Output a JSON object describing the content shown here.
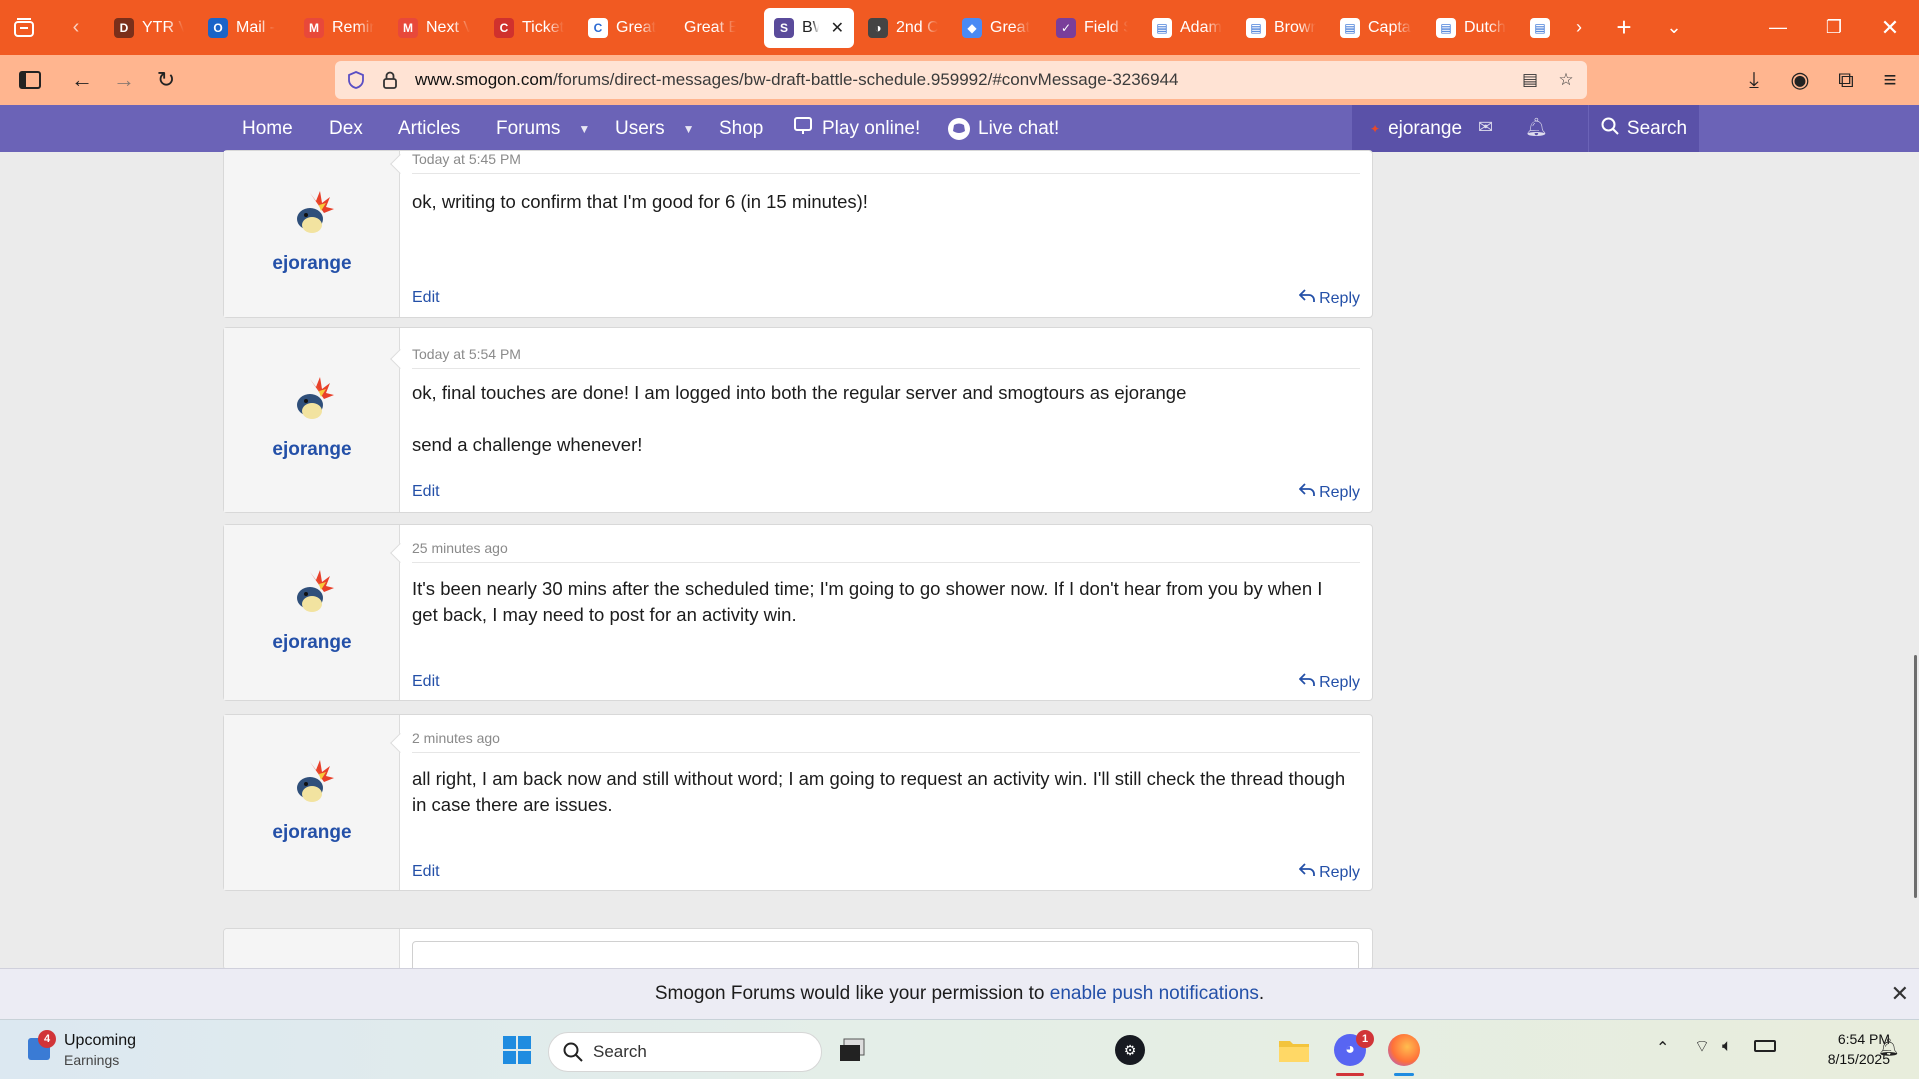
{
  "browser": {
    "tabs": [
      {
        "label": "YTR V",
        "icon": "D",
        "color": "#7a2f1a"
      },
      {
        "label": "Mail -",
        "icon": "O",
        "color": "#1a64c8"
      },
      {
        "label": "Remin",
        "icon": "M",
        "color": "#e8483a"
      },
      {
        "label": "Next V",
        "icon": "M",
        "color": "#e8483a"
      },
      {
        "label": "Ticket",
        "icon": "C",
        "color": "#d0312d"
      },
      {
        "label": "Great",
        "icon": "C",
        "color": "#ffffff"
      },
      {
        "label": "Great Brid",
        "icon": "",
        "color": "transparent"
      },
      {
        "label": "BW",
        "icon": "S",
        "color": "#5a4b9b"
      },
      {
        "label": "2nd C",
        "icon": "◑",
        "color": "#444444"
      },
      {
        "label": "Great",
        "icon": "◆",
        "color": "#4a8af4"
      },
      {
        "label": "Field S",
        "icon": "✓",
        "color": "#7a3e9a"
      },
      {
        "label": "Adam",
        "icon": "▤",
        "color": "#ffffff"
      },
      {
        "label": "Brown",
        "icon": "▤",
        "color": "#ffffff"
      },
      {
        "label": "Captai",
        "icon": "▤",
        "color": "#ffffff"
      },
      {
        "label": "Dutch",
        "icon": "▤",
        "color": "#ffffff"
      },
      {
        "label": "",
        "icon": "▤",
        "color": "#ffffff"
      }
    ],
    "active_tab_index": 7,
    "url_host": "www.smogon.com",
    "url_path": "/forums/direct-messages/bw-draft-battle-schedule.959992/#convMessage-3236944"
  },
  "site_nav": {
    "home": "Home",
    "dex": "Dex",
    "articles": "Articles",
    "forums": "Forums",
    "users": "Users",
    "shop": "Shop",
    "play": "Play online!",
    "chat": "Live chat!",
    "account": "ejorange",
    "search": "Search"
  },
  "messages": [
    {
      "user": "ejorange",
      "time": "Today at 5:45 PM",
      "paragraphs": [
        "ok, writing to confirm that I'm good for 6 (in 15 minutes)!"
      ],
      "edit": "Edit",
      "reply": "Reply"
    },
    {
      "user": "ejorange",
      "time": "Today at 5:54 PM",
      "paragraphs": [
        "ok, final touches are done! I am logged into both the regular server and smogtours as ejorange",
        "send a challenge whenever!"
      ],
      "edit": "Edit",
      "reply": "Reply"
    },
    {
      "user": "ejorange",
      "time": "25 minutes ago",
      "paragraphs": [
        "It's been nearly 30 mins after the scheduled time; I'm going to go shower now. If I don't hear from you by when I get back, I may need to post for an activity win."
      ],
      "edit": "Edit",
      "reply": "Reply"
    },
    {
      "user": "ejorange",
      "time": "2 minutes ago",
      "paragraphs": [
        "all right, I am back now and still without word; I am going to request an activity win. I'll still check the thread though in case there are issues."
      ],
      "edit": "Edit",
      "reply": "Reply"
    }
  ],
  "notification": {
    "text": "Smogon Forums would like your permission to ",
    "link": "enable push notifications",
    "tail": "."
  },
  "taskbar": {
    "widget_badge": "4",
    "widget_title": "Upcoming",
    "widget_sub": "Earnings",
    "search_placeholder": "Search",
    "discord_badge": "1",
    "time": "6:54 PM",
    "date": "8/15/2025"
  }
}
